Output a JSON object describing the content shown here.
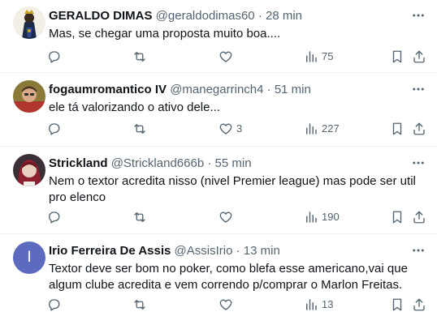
{
  "tweets": [
    {
      "author": "GERALDO DIMAS",
      "handle": "@geraldodimas60",
      "separator": "·",
      "time": "28 min",
      "text": "Mas, se chegar uma proposta muito boa....",
      "replies": "",
      "retweets": "",
      "likes": "",
      "views": "75",
      "avatar": "figure-avatar"
    },
    {
      "author": "fogaumromantico IV",
      "handle": "@manegarrinch4",
      "separator": "·",
      "time": "51 min",
      "text": "ele tá valorizando o ativo dele...",
      "replies": "",
      "retweets": "",
      "likes": "3",
      "views": "227",
      "avatar": "person-avatar"
    },
    {
      "author": "Strickland",
      "handle": "@Strickland666b",
      "separator": "·",
      "time": "55 min",
      "text": "Nem o textor acredita nisso (nivel Premier league) mas pode ser util pro elenco",
      "replies": "",
      "retweets": "",
      "likes": "",
      "views": "190",
      "avatar": "person-avatar"
    },
    {
      "author": "Irio Ferreira De Assis",
      "handle": "@AssisIrio",
      "separator": "·",
      "time": "13 min",
      "text": "Textor deve ser bom no poker,  como blefa esse americano,vai que algum clube acredita e vem correndo p/comprar o Marlon Freitas.",
      "replies": "",
      "retweets": "",
      "likes": "",
      "views": "13",
      "avatar": "initial-avatar",
      "avatar_initial": "I",
      "avatar_color": "#5c6bc0"
    }
  ],
  "colors": {
    "text": "#0f1419",
    "secondary": "#536471",
    "border": "#eff3f4",
    "background": "#ffffff"
  }
}
